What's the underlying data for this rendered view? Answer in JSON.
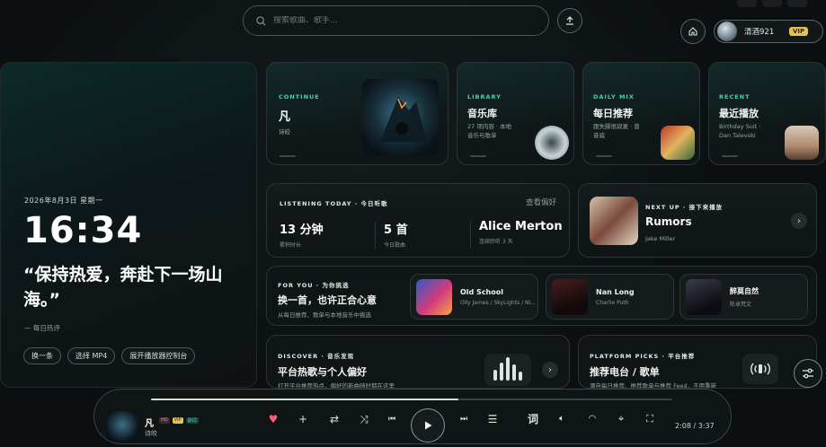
{
  "search": {
    "placeholder": "搜索歌曲、歌手..."
  },
  "user": {
    "name": "清酒921",
    "badge": "VIP"
  },
  "hero": {
    "date": "2026年8月3日 星期一",
    "time": "16:34",
    "quote": "“保持热爱，奔赴下一场山海。”",
    "source": "— 每日热评",
    "buttons": [
      "换一条",
      "选择 MP4",
      "展开播放器控制台"
    ]
  },
  "cards": {
    "continue": {
      "kicker": "CONTINUE",
      "title": "凡",
      "subtitle": "诗皎"
    },
    "library": {
      "kicker": "LIBRARY",
      "title": "音乐库",
      "line1": "27 项内容 · 本地",
      "line2": "音乐与歌单"
    },
    "daily": {
      "kicker": "DAILY MIX",
      "title": "每日推荐",
      "line1": "跟失脚很寂寞 · 曾",
      "line2": "昔威"
    },
    "recent": {
      "kicker": "RECENT",
      "title": "最近播放",
      "line1": "Birthday Suit · ",
      "line2": "Dan Talevski"
    }
  },
  "listening": {
    "kicker": "LISTENING TODAY · 今日听歌",
    "pref_link": "查看偏好",
    "stats": [
      {
        "value": "13 分钟",
        "label": "累积时长"
      },
      {
        "value": "5 首",
        "label": "今日歌曲"
      },
      {
        "value": "Alice Merton",
        "label": "连续聆听 3 天"
      }
    ]
  },
  "next_up": {
    "kicker": "NEXT UP · 接下来播放",
    "title": "Rumors",
    "artist": "Jake Miller"
  },
  "for_you": {
    "kicker": "FOR YOU · 为你挑选",
    "title": "换一首，也许正合心意",
    "subtitle": "从每日推荐、歌单与本地音乐中挑选",
    "items": [
      {
        "title": "Old School",
        "artist": "Olly James / SkyLights / NI..."
      },
      {
        "title": "Nan Long",
        "artist": "Charlie Puth"
      },
      {
        "title": "醉莫自然",
        "artist": "陈卓梵文"
      }
    ]
  },
  "discover": {
    "kicker": "DISCOVER · 音乐发现",
    "title": "平台热歌与个人偏好",
    "subtitle": "打开平台推荐热点，偏好的新曲随时都在这里"
  },
  "platform": {
    "kicker": "PLATFORM PICKS · 平台推荐",
    "title": "推荐电台 / 歌单",
    "subtitle": "源自每日推荐、推荐歌单与推荐 Feed，不用重新"
  },
  "player": {
    "title": "凡",
    "artist": "诗皎",
    "badge_hq": "HQ",
    "badge_vip": "VIP",
    "badge_lyric": "歌词",
    "lyrics_btn": "词",
    "time": "2:08 / 3:37",
    "progress": 0.59
  },
  "colors": {
    "accent": "#3ad6b8",
    "vip": "#e2c25a",
    "heart": "#ff5a7a"
  }
}
